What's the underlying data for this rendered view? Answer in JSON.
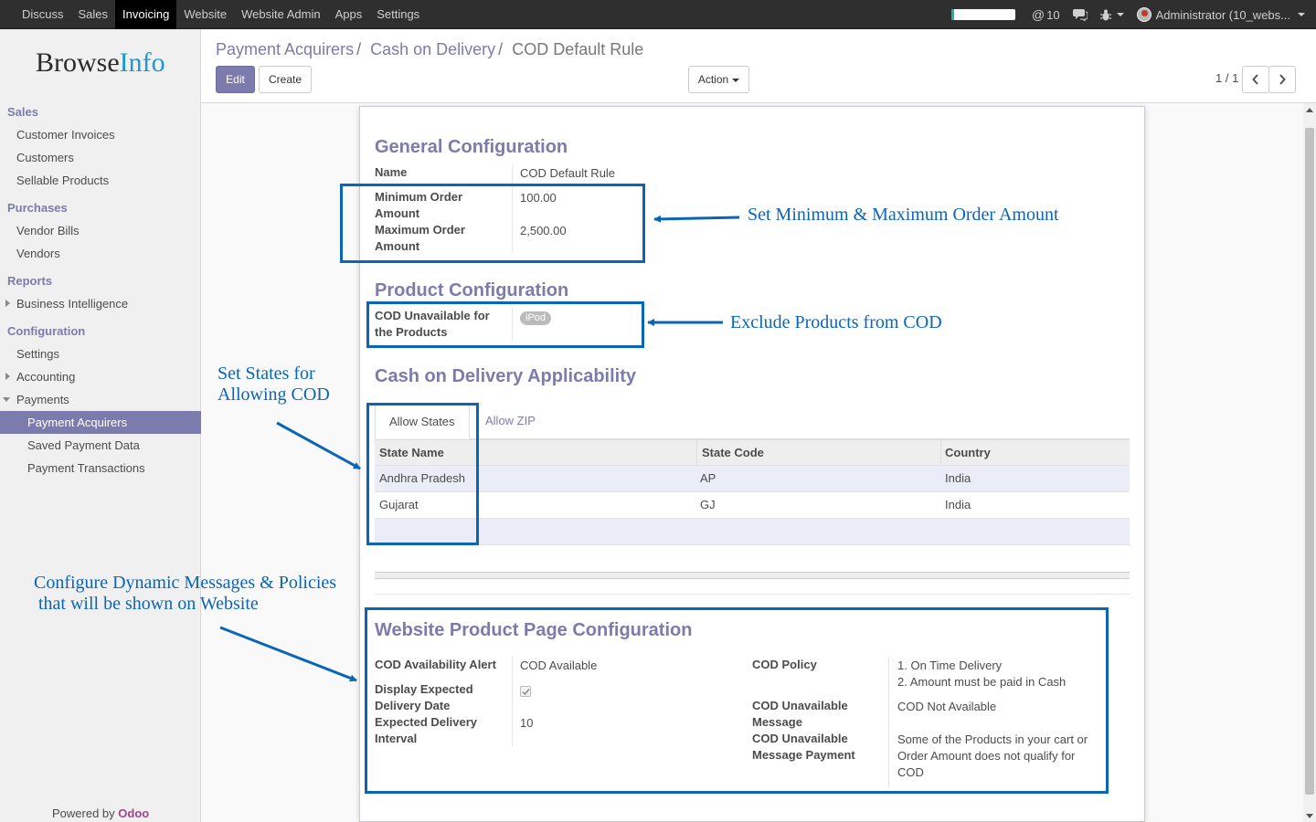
{
  "topbar": {
    "apps": [
      "Discuss",
      "Sales",
      "Invoicing",
      "Website",
      "Website Admin",
      "Apps",
      "Settings"
    ],
    "active_app": "Invoicing",
    "progress_fraction": 0.05,
    "mention_count": "10",
    "user_label": "Administrator (10_webs..."
  },
  "sidebar": {
    "logo_part1": "Browse",
    "logo_part2": "Info",
    "sections": {
      "sales": "Sales",
      "sales_items": [
        "Customer Invoices",
        "Customers",
        "Sellable Products"
      ],
      "purchases": "Purchases",
      "purchases_items": [
        "Vendor Bills",
        "Vendors"
      ],
      "reports": "Reports",
      "reports_items": [
        "Business Intelligence"
      ],
      "configuration": "Configuration",
      "config_items": [
        "Settings",
        "Accounting",
        "Payments"
      ],
      "payments_items": [
        "Payment Acquirers",
        "Saved Payment Data",
        "Payment Transactions"
      ]
    },
    "powered_prefix": "Powered by",
    "powered_brand": "Odoo"
  },
  "control_panel": {
    "breadcrumb": [
      "Payment Acquirers",
      "Cash on Delivery",
      "COD Default Rule"
    ],
    "edit_label": "Edit",
    "create_label": "Create",
    "action_label": "Action",
    "pager": "1 / 1"
  },
  "form": {
    "general": {
      "title": "General Configuration",
      "name_label": "Name",
      "name_value": "COD Default Rule",
      "min_label_1": "Minimum Order",
      "min_label_2": "Amount",
      "min_value": "100.00",
      "max_label_1": "Maximum Order",
      "max_label_2": "Amount",
      "max_value": "2,500.00"
    },
    "product": {
      "title": "Product Configuration",
      "label_1": "COD Unavailable for",
      "label_2": "the Products",
      "tag": "iPod"
    },
    "applicability": {
      "title": "Cash on Delivery Applicability",
      "tabs": [
        "Allow States",
        "Allow ZIP"
      ],
      "columns": [
        "State Name",
        "State Code",
        "Country"
      ],
      "rows": [
        {
          "state": "Andhra Pradesh",
          "code": "AP",
          "country": "India"
        },
        {
          "state": "Gujarat",
          "code": "GJ",
          "country": "India"
        }
      ]
    },
    "website": {
      "title": "Website Product Page Configuration",
      "alert_label": "COD Availability Alert",
      "alert_value": "COD Available",
      "display_label_1": "Display Expected",
      "display_label_2": "Delivery Date",
      "display_checked": true,
      "interval_label_1": "Expected Delivery",
      "interval_label_2": "Interval",
      "interval_value": "10",
      "policy_label": "COD Policy",
      "policy_line_1": "1. On Time Delivery",
      "policy_line_2": "2. Amount must be paid in Cash",
      "unavail_msg_label_1": "COD Unavailable",
      "unavail_msg_label_2": "Message",
      "unavail_msg_value": "COD Not Available",
      "unavail_pay_label_1": "COD Unavailable",
      "unavail_pay_label_2": "Message Payment",
      "unavail_pay_line_1": "Some of the Products in your cart or",
      "unavail_pay_line_2": "Order Amount does not qualify for",
      "unavail_pay_line_3": "COD"
    }
  },
  "annotations": {
    "min_max": "Set Minimum & Maximum Order Amount",
    "exclude": "Exclude Products from COD",
    "states_1": "Set States for",
    "states_2": "Allowing COD",
    "messages_1": "Configure Dynamic Messages & Policies",
    "messages_2": "that will be shown on Website"
  },
  "colors": {
    "accent": "#7c7bad",
    "annotation_blue": "#0b65b7",
    "topbar": "#2f2f2f"
  }
}
